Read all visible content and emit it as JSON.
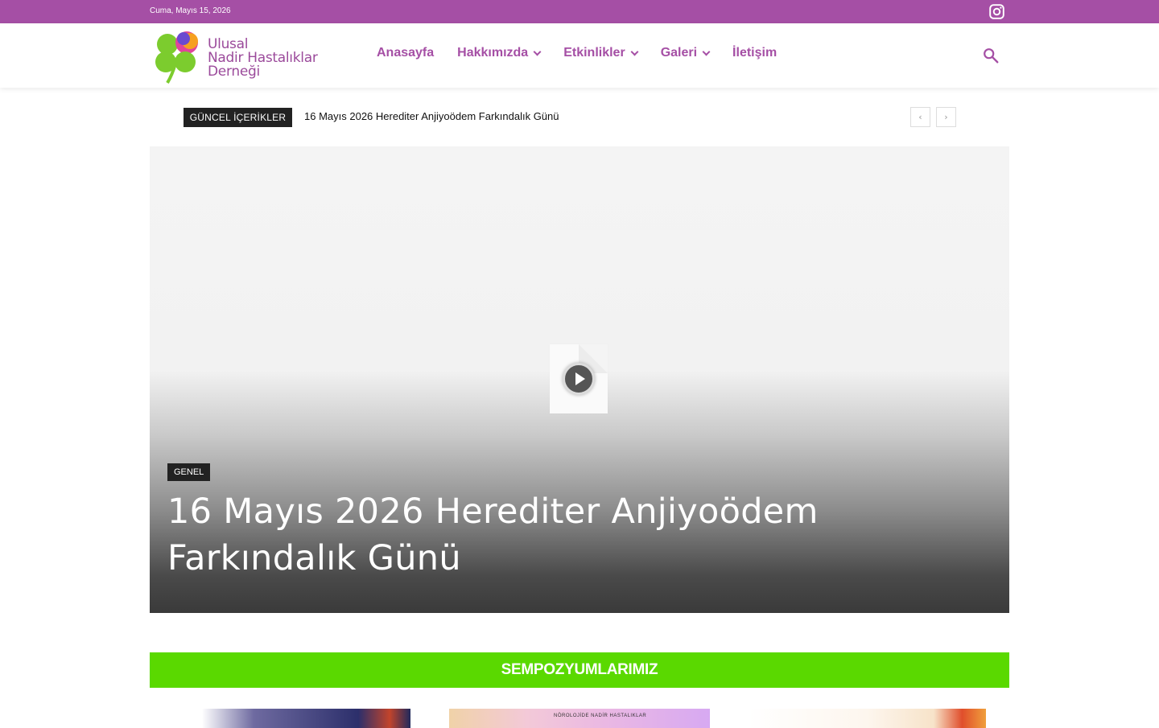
{
  "topbar": {
    "date": "Cuma, Mayıs 15, 2026",
    "social_icon": "instagram-icon"
  },
  "header": {
    "logo_lines": [
      "Ulusal",
      "Nadir Hastalıklar",
      "Derneği"
    ],
    "nav": [
      {
        "label": "Anasayfa",
        "has_dropdown": false
      },
      {
        "label": "Hakkımızda",
        "has_dropdown": true
      },
      {
        "label": "Etkinlikler",
        "has_dropdown": true
      },
      {
        "label": "Galeri",
        "has_dropdown": true
      },
      {
        "label": "İletişim",
        "has_dropdown": false
      }
    ],
    "search_icon": "search-icon"
  },
  "ticker": {
    "label": "GÜNCEL İÇERİKLER",
    "headline": "16 Mayıs 2026 Herediter Anjiyoödem Farkındalık Günü",
    "prev": "‹",
    "next": "›"
  },
  "hero": {
    "category": "GENEL",
    "title": "16 Mayıs 2026 Herediter Anjiyoödem Farkındalık Günü"
  },
  "section": {
    "title": "SEMPOZYUMLARIMIZ"
  },
  "thumbs": [
    {
      "caption": ""
    },
    {
      "caption": "NÖROLOJİDE NADİR HASTALIKLAR"
    },
    {
      "caption": ""
    }
  ],
  "colors": {
    "brand_purple": "#a54fa5",
    "section_green": "#5ad900",
    "dark_label": "#222222"
  }
}
